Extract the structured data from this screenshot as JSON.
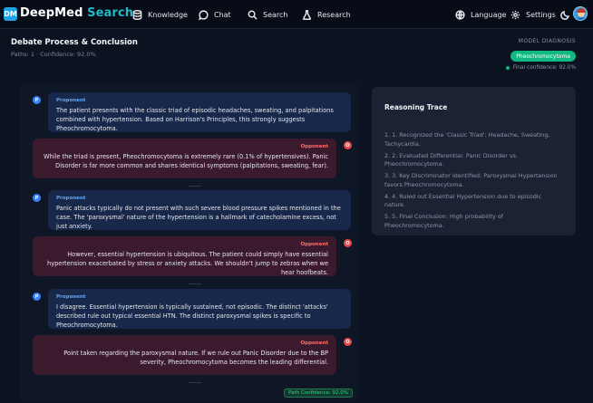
{
  "nav": {
    "logo_icon_text": "DM",
    "brand_main": "DeepMed",
    "brand_accent": "Search",
    "items": [
      {
        "label": "Knowledge",
        "icon": "database-icon"
      },
      {
        "label": "Chat",
        "icon": "chat-bubble-icon"
      },
      {
        "label": "Search",
        "icon": "search-icon"
      },
      {
        "label": "Research",
        "icon": "flask-icon"
      }
    ],
    "language_label": "Language",
    "language_icon": "globe-icon",
    "settings_label": "Settings",
    "settings_icon": "gear-icon",
    "theme_icon": "moon-icon",
    "avatar_icon": "user-avatar"
  },
  "header": {
    "title": "Debate Process & Conclusion",
    "meta": "Paths: 1  ·  Confidence: 92.0%",
    "diagnosis_label": "MODEL DIAGNOSIS",
    "diagnosis_value": "Pheochromocytoma",
    "final_confidence": "Final confidence: 92.0%"
  },
  "debate": {
    "messages": [
      {
        "role": "Proponent",
        "badge": "P",
        "text": "The patient presents with the classic triad of episodic headaches, sweating, and palpitations combined with hypertension. Based on Harrison's Principles, this strongly suggests Pheochromocytoma."
      },
      {
        "role": "Opponent",
        "badge": "O",
        "text": "While the triad is present, Pheochromocytoma is extremely rare (0.1% of hypertensives). Panic Disorder is far more common and shares identical symptoms (palpitations, sweating, fear)."
      },
      {
        "role": "Proponent",
        "badge": "P",
        "text": "Panic attacks typically do not present with such severe blood pressure spikes mentioned in the case. The 'paroxysmal' nature of the hypertension is a hallmark of catecholamine excess, not just anxiety."
      },
      {
        "role": "Opponent",
        "badge": "O",
        "text": "However, essential hypertension is ubiquitous. The patient could simply have essential hypertension exacerbated by stress or anxiety attacks. We shouldn't jump to zebras when we hear hoofbeats."
      },
      {
        "role": "Proponent",
        "badge": "P",
        "text": "I disagree. Essential hypertension is typically sustained, not episodic. The distinct 'attacks' described rule out typical essential HTN. The distinct paroxysmal spikes is specific to Pheochromocytoma."
      },
      {
        "role": "Opponent",
        "badge": "O",
        "text": "Point taken regarding the paroxysmal nature. If we rule out Panic Disorder due to the BP severity, Pheochromocytoma becomes the leading differential."
      }
    ],
    "path_confidence": "Path Confidence: 92.0%"
  },
  "trace": {
    "title": "Reasoning Trace",
    "items": [
      "1. 1. Recognized the 'Classic Triad': Headache, Sweating, Tachycardia.",
      "2. 2. Evaluated Differential: Panic Disorder vs. Pheochromocytoma.",
      "3. 3. Key Discriminator Identified: Paroxysmal Hypertension favors Pheochromocytoma.",
      "4. 4. Ruled out Essential Hypertension due to episodic nature.",
      "5. 5. Final Conclusion: High probability of Pheochromocytoma."
    ]
  },
  "colors": {
    "background": "#0b1220",
    "brand_accent": "#22b8c7",
    "proponent": "#3b82f6",
    "opponent": "#ef4444",
    "success": "#10b981"
  }
}
